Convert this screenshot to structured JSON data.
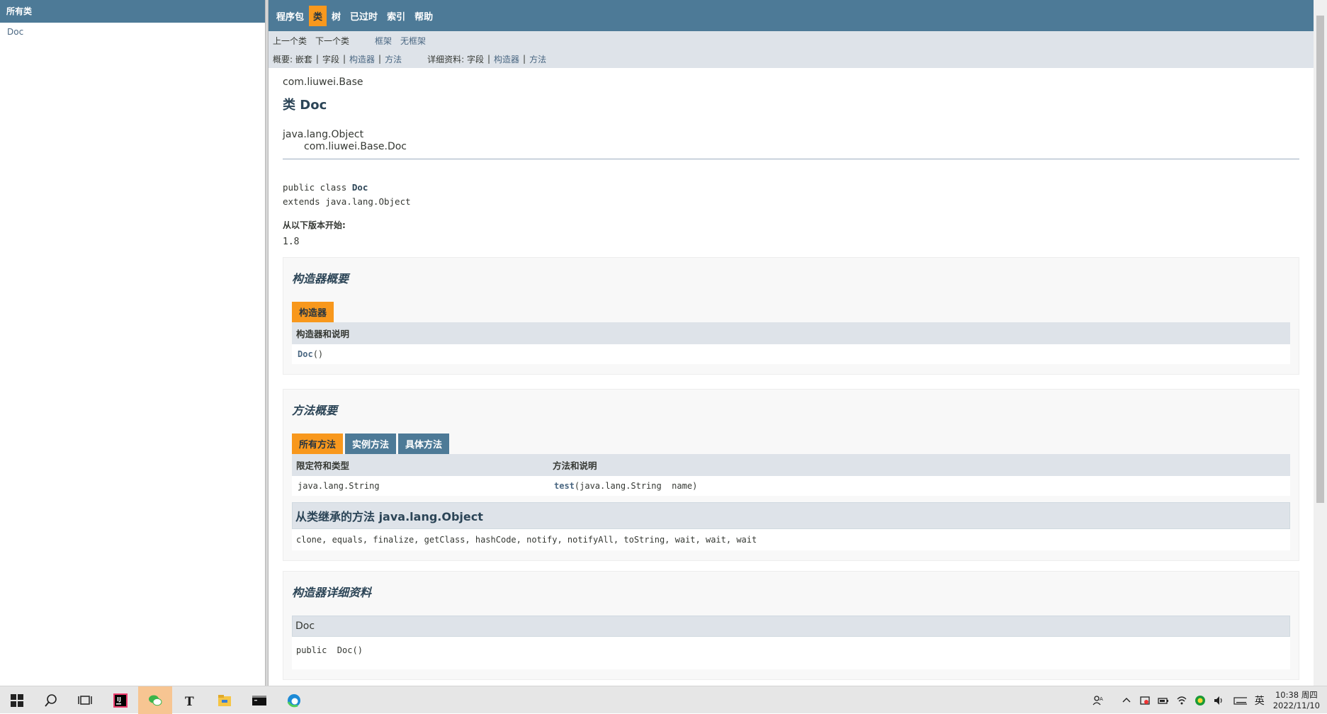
{
  "left_frame": {
    "header": "所有类",
    "classes": [
      "Doc"
    ]
  },
  "topnav": {
    "items": [
      "程序包",
      "类",
      "树",
      "已过时",
      "索引",
      "帮助"
    ],
    "active": "类"
  },
  "subnav1": {
    "prev_class": "上一个类",
    "next_class": "下一个类",
    "frames": "框架",
    "no_frames": "无框架"
  },
  "subnav2": {
    "summary_label": "概要:",
    "summary_nested": "嵌套",
    "summary_field": "字段",
    "summary_constructor": "构造器",
    "summary_method": "方法",
    "detail_label": "详细资料:",
    "detail_field": "字段",
    "detail_constructor": "构造器",
    "detail_method": "方法"
  },
  "header": {
    "package": "com.liuwei.Base",
    "title": "类 Doc",
    "inheritance_root": "java.lang.Object",
    "inheritance_child": "com.liuwei.Base.Doc"
  },
  "signature": {
    "line1_prefix": "public class ",
    "line1_name": "Doc",
    "line2": "extends java.lang.Object"
  },
  "since": {
    "label": "从以下版本开始:",
    "value": "1.8"
  },
  "constructor_summary": {
    "title": "构造器概要",
    "tab": "构造器",
    "column": "构造器和说明",
    "row_name": "Doc",
    "row_suffix": "()"
  },
  "method_summary": {
    "title": "方法概要",
    "tabs": [
      "所有方法",
      "实例方法",
      "具体方法"
    ],
    "col1": "限定符和类型",
    "col2": "方法和说明",
    "row_type": "java.lang.String",
    "row_method": "test",
    "row_params": "(java.lang.String  name)",
    "inherited_title": "从类继承的方法 java.lang.Object",
    "inherited_list": "clone, equals, finalize, getClass, hashCode, notify, notifyAll, toString, wait, wait, wait"
  },
  "constructor_detail": {
    "title": "构造器详细资料",
    "head": "Doc",
    "body": "public  Doc()"
  },
  "taskbar": {
    "apps": [
      "start-icon",
      "search-icon",
      "task-view-icon",
      "intellij-icon",
      "wechat-icon",
      "typora-icon",
      "file-explorer-icon",
      "terminal-icon",
      "edge-icon"
    ],
    "ime": "英",
    "time": "10:38 周四",
    "date": "2022/11/10"
  }
}
